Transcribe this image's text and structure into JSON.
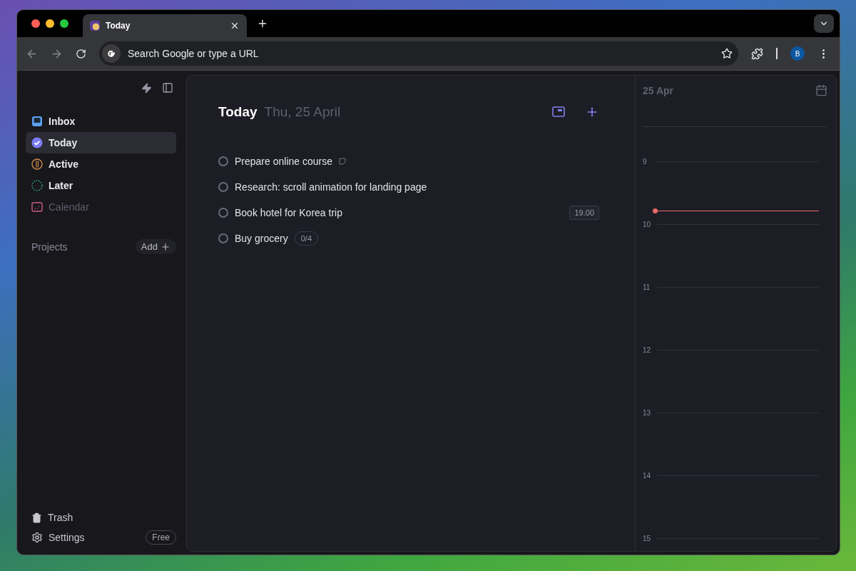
{
  "browser": {
    "tabs": [
      {
        "title": "Today",
        "selected": true
      }
    ],
    "address_placeholder": "Search Google or type a URL",
    "profile": "B"
  },
  "sidebar": {
    "nav": [
      {
        "label": "Inbox",
        "kind": "inbox",
        "selected": false,
        "disabled": false
      },
      {
        "label": "Today",
        "kind": "today",
        "selected": true,
        "disabled": false
      },
      {
        "label": "Active",
        "kind": "active",
        "selected": false,
        "disabled": false
      },
      {
        "label": "Later",
        "kind": "later",
        "selected": false,
        "disabled": false
      },
      {
        "label": "Calendar",
        "kind": "calendar",
        "selected": false,
        "disabled": true
      }
    ],
    "projects": {
      "label": "Projects",
      "add": "Add"
    },
    "footer": {
      "trash": "Trash",
      "settings": "Settings",
      "plan": "Free"
    }
  },
  "main": {
    "title": "Today",
    "date": "Thu, 25 April",
    "tasks": [
      {
        "title": "Prepare online course",
        "done": false,
        "kind": "note"
      },
      {
        "title": "Research: scroll animation for landing page",
        "done": false,
        "kind": "plain"
      },
      {
        "title": "Book hotel for Korea trip",
        "done": false,
        "kind": "time",
        "badge": "19.00"
      },
      {
        "title": "Buy grocery",
        "done": false,
        "kind": "subtasks",
        "badge": "0/4"
      }
    ]
  },
  "calendar": {
    "date": "25 Apr",
    "hours": [
      "9",
      "10",
      "11",
      "12",
      "13",
      "14",
      "15"
    ]
  }
}
